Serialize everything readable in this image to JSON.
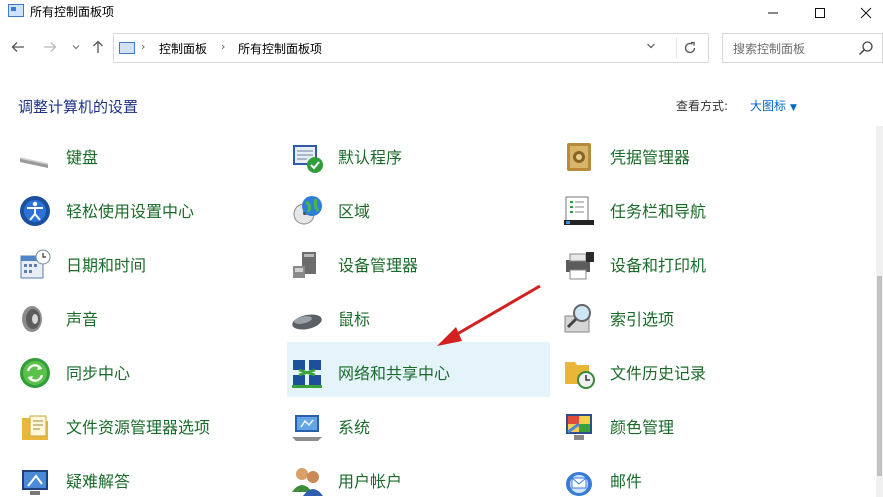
{
  "window": {
    "title": "所有控制面板项",
    "minimize_icon": "minimize-icon",
    "maximize_icon": "maximize-icon",
    "close_icon": "close-icon"
  },
  "address": {
    "crumbs": [
      "控制面板",
      "所有控制面板项"
    ]
  },
  "search": {
    "placeholder": "搜索控制面板"
  },
  "header": {
    "title": "调整计算机的设置",
    "view_label": "查看方式:",
    "view_value": "大图标"
  },
  "items": {
    "col1": [
      "键盘",
      "轻松使用设置中心",
      "日期和时间",
      "声音",
      "同步中心",
      "文件资源管理器选项",
      "疑难解答"
    ],
    "col2": [
      "默认程序",
      "区域",
      "设备管理器",
      "鼠标",
      "网络和共享中心",
      "系统",
      "用户帐户"
    ],
    "col3": [
      "凭据管理器",
      "任务栏和导航",
      "设备和打印机",
      "索引选项",
      "文件历史记录",
      "颜色管理",
      "邮件"
    ]
  },
  "highlighted_item": "网络和共享中心",
  "colors": {
    "label_green": "#1a6b2a",
    "heading_blue": "#1e3287",
    "link_blue": "#0066cc",
    "hover_bg": "#e5f3fb",
    "arrow_red": "#d32020"
  }
}
